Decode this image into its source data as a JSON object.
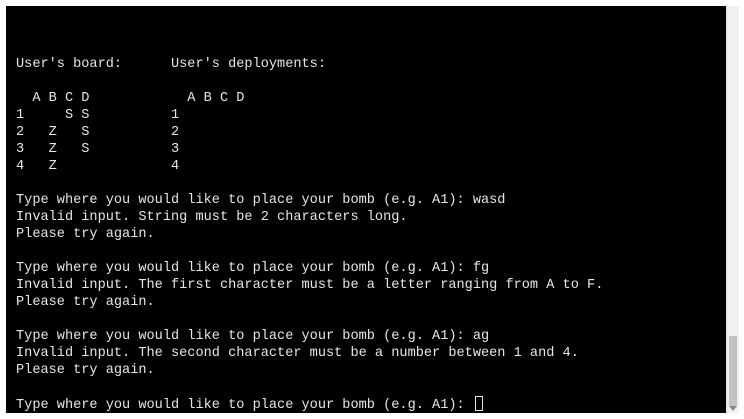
{
  "terminal": {
    "lines": [
      "User's board:      User's deployments:",
      "",
      "  A B C D            A B C D",
      "1     S S          1",
      "2   Z   S          2",
      "3   Z   S          3",
      "4   Z              4",
      "",
      "Type where you would like to place your bomb (e.g. A1): wasd",
      "Invalid input. String must be 2 characters long.",
      "Please try again.",
      "",
      "Type where you would like to place your bomb (e.g. A1): fg",
      "Invalid input. The first character must be a letter ranging from A to F.",
      "Please try again.",
      "",
      "Type where you would like to place your bomb (e.g. A1): ag",
      "Invalid input. The second character must be a number between 1 and 4.",
      "Please try again.",
      ""
    ],
    "prompt": "Type where you would like to place your bomb (e.g. A1): "
  },
  "colors": {
    "background": "#000000",
    "text": "#e6e6e6"
  }
}
